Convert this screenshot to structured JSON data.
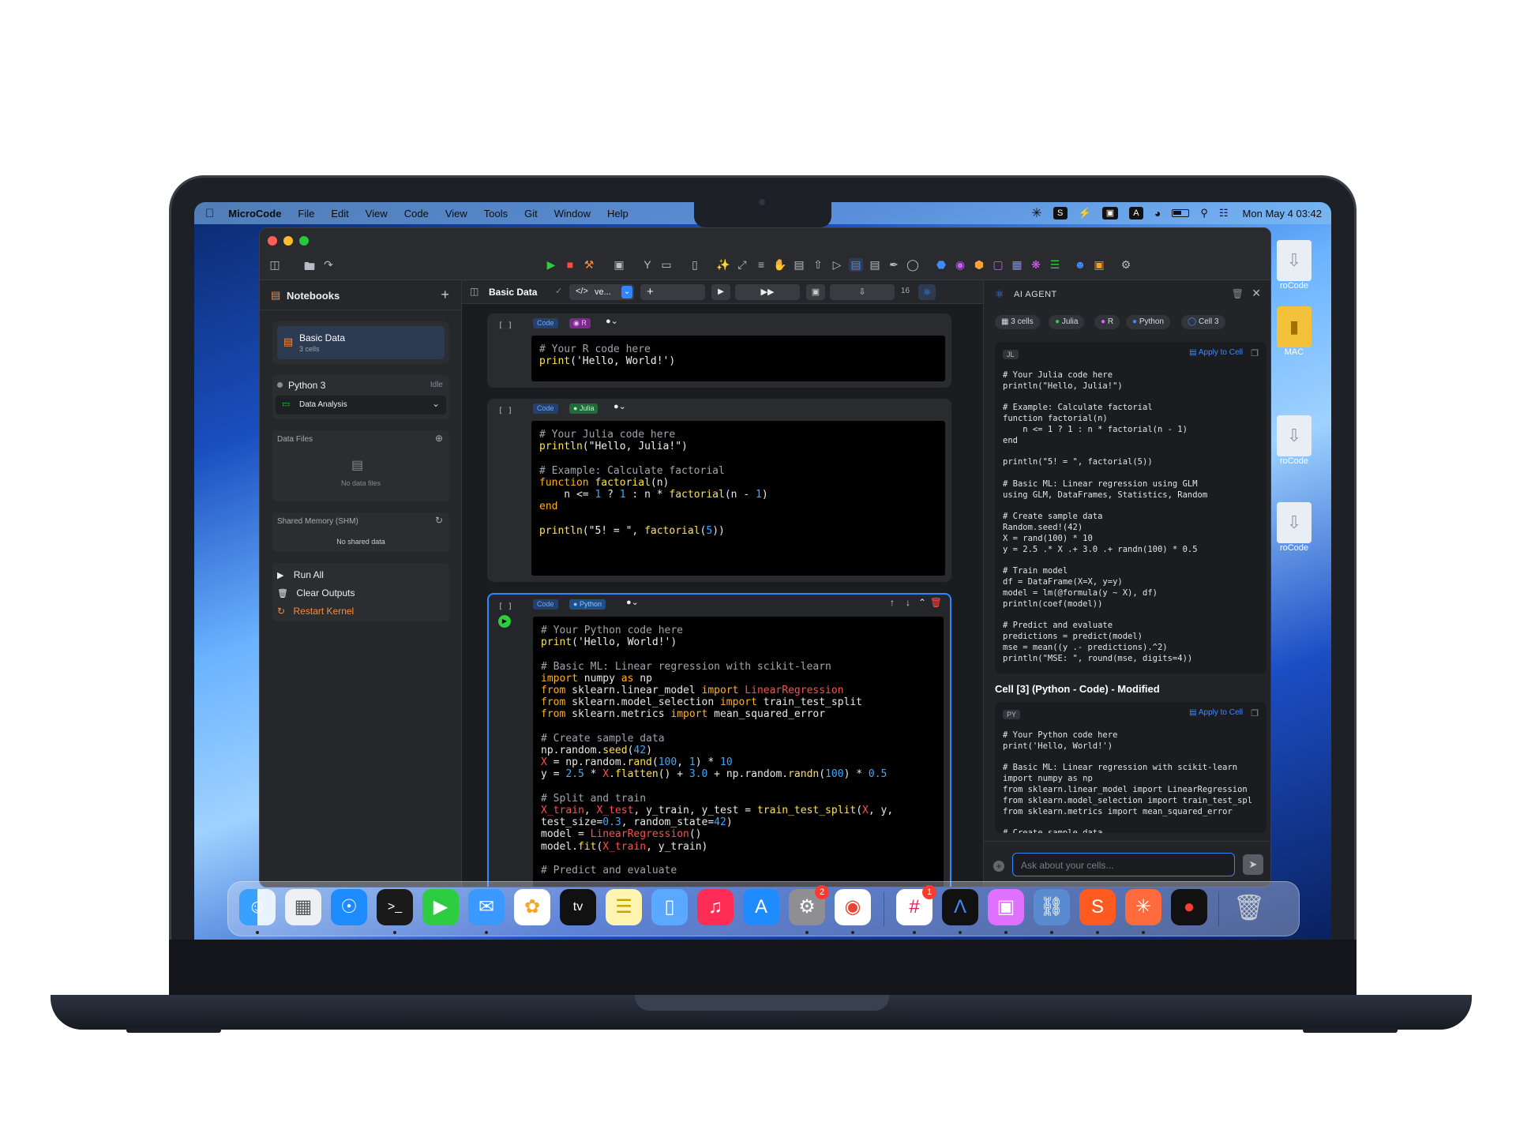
{
  "menubar": {
    "app": "MicroCode",
    "items": [
      "File",
      "Edit",
      "View",
      "Code",
      "View",
      "Tools",
      "Git",
      "Window",
      "Help"
    ],
    "clock": "Mon May 4  03:42"
  },
  "desktop": {
    "labels": [
      "roCode",
      "MAC",
      "roCode",
      "roCode"
    ]
  },
  "sidebar": {
    "title": "Notebooks",
    "add": "+",
    "notebook": {
      "name": "Basic Data",
      "cells": "3 cells"
    },
    "kernel": {
      "name": "Python 3",
      "status": "Idle"
    },
    "env": "Data Analysis",
    "data_files": {
      "title": "Data Files",
      "empty": "No data files"
    },
    "shm": {
      "title": "Shared Memory (SHM)",
      "empty": "No shared data"
    },
    "actions": {
      "run_all": "Run All",
      "clear": "Clear Outputs",
      "restart": "Restart Kernel"
    }
  },
  "editor": {
    "title": "Basic Data",
    "view_select": "ve...",
    "add": "+",
    "count": "16",
    "cells": [
      {
        "prompt": "[ ]",
        "type": "Code",
        "lang": "R"
      },
      {
        "prompt": "[ ]",
        "type": "Code",
        "lang": "Julia"
      },
      {
        "prompt": "[ ]",
        "type": "Code",
        "lang": "Python"
      }
    ]
  },
  "agent": {
    "title": "AI AGENT",
    "chips": [
      "3 cells",
      "Julia",
      "R",
      "Python",
      "Cell 3"
    ],
    "block1_lang": "JL",
    "apply": "Apply to Cell",
    "section": "Cell [3] (Python - Code) - Modified",
    "block2_lang": "PY",
    "input_placeholder": "Ask about your cells..."
  },
  "colors": {
    "accent": "#2f86ff",
    "run": "#2ecc40",
    "restart": "#ff8a33",
    "bg": "#1f2024"
  },
  "dock": {
    "badges": {
      "settings": "2",
      "slack": "1"
    }
  }
}
